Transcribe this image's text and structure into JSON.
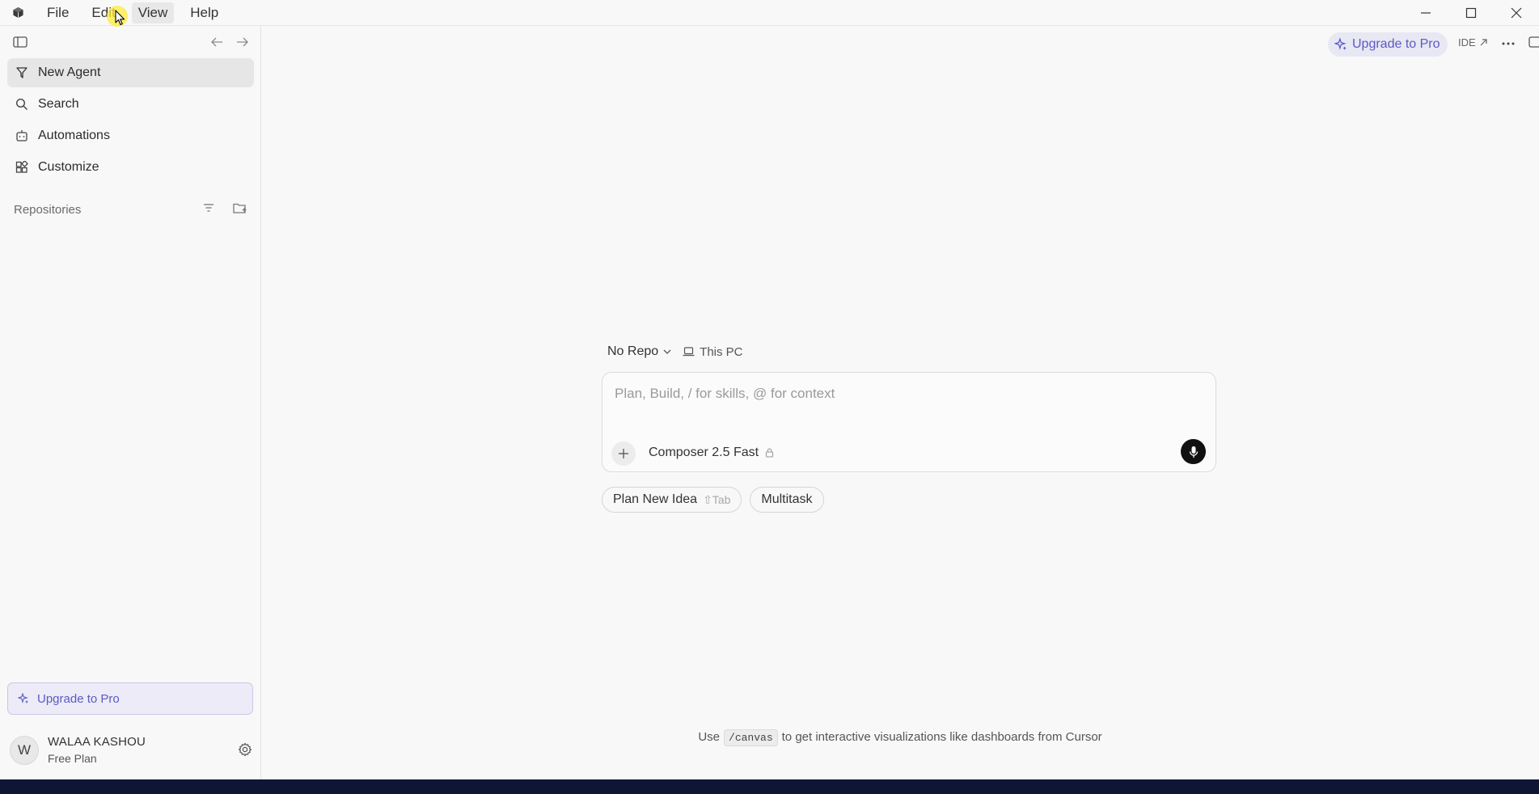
{
  "titlebar": {
    "menu": [
      "File",
      "Edit",
      "View",
      "Help"
    ],
    "icons": {
      "logo": "cube-logo-icon",
      "minimize": "minimize-icon",
      "maximize": "maximize-icon",
      "close": "close-icon"
    }
  },
  "sidebar": {
    "items": [
      {
        "label": "New Agent",
        "icon": "new-agent-icon",
        "active": true
      },
      {
        "label": "Search",
        "icon": "search-icon"
      },
      {
        "label": "Automations",
        "icon": "robot-icon"
      },
      {
        "label": "Customize",
        "icon": "blocks-icon"
      }
    ],
    "repositories_label": "Repositories",
    "upgrade_label": "Upgrade to Pro",
    "user": {
      "initial": "W",
      "name": "WALAA KASHOU",
      "plan": "Free Plan"
    }
  },
  "topbar": {
    "upgrade_label": "Upgrade to Pro",
    "ide_label": "IDE"
  },
  "composer": {
    "repo_label": "No Repo",
    "location_label": "This PC",
    "placeholder": "Plan, Build, / for skills, @ for context",
    "value": "",
    "model_label": "Composer 2.5 Fast"
  },
  "chips": {
    "plan_label": "Plan New Idea",
    "plan_shortcut": "⇧Tab",
    "multitask_label": "Multitask"
  },
  "hint": {
    "prefix": "Use",
    "code": "/canvas",
    "suffix": "to get interactive visualizations like dashboards from Cursor"
  },
  "colors": {
    "accent": "#5b5bc0",
    "taskbar": "#0f1535"
  }
}
